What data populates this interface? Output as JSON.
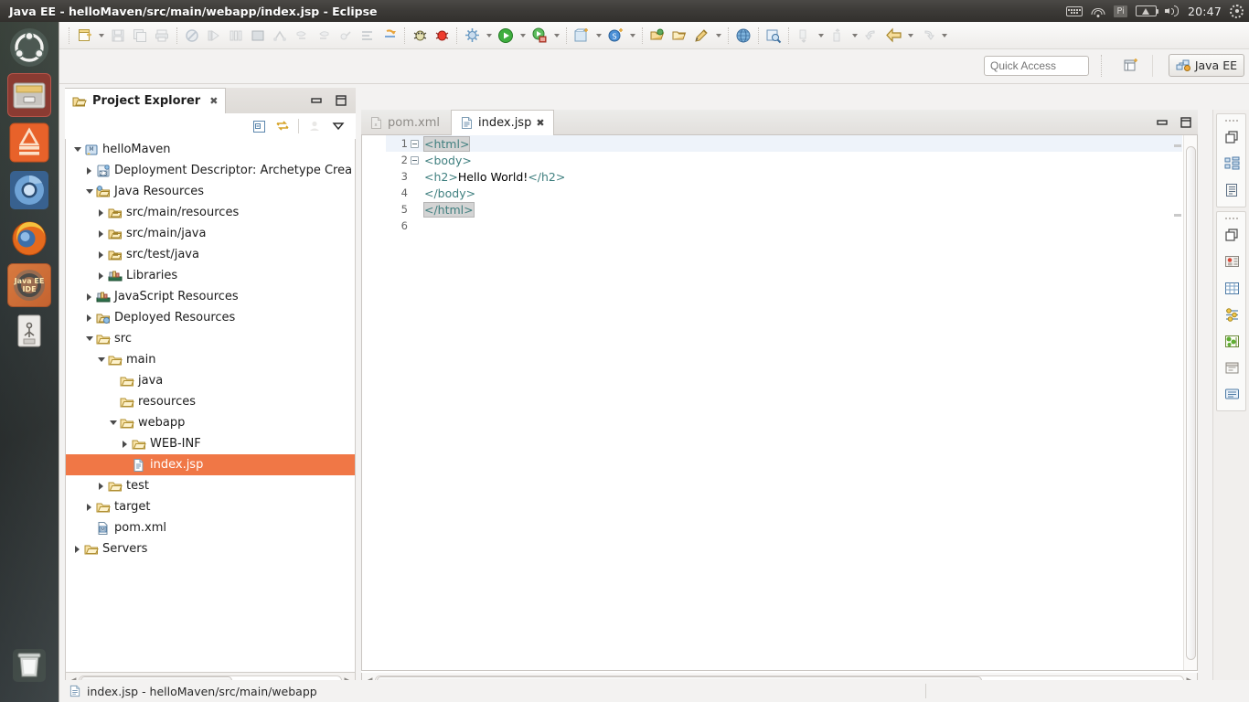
{
  "window": {
    "title": "Java EE - helloMaven/src/main/webapp/index.jsp - Eclipse"
  },
  "tray": {
    "keyboard_icon": "keyboard-icon",
    "wifi_icon": "wifi-icon",
    "pi_label": "Pi",
    "battery_icon": "battery-icon",
    "volume_icon": "volume-icon",
    "clock": "20:47",
    "session_icon": "gear-icon"
  },
  "launcher": {
    "items": [
      {
        "name": "ubuntu-dash",
        "label": "Ubuntu",
        "active": false
      },
      {
        "name": "files",
        "label": "Files",
        "active": false
      },
      {
        "name": "amazon",
        "label": "Amazon",
        "active": false
      },
      {
        "name": "chromium",
        "label": "Chromium Web Browser",
        "active": false
      },
      {
        "name": "firefox",
        "label": "Firefox Web Browser",
        "active": false
      },
      {
        "name": "java-ee-ide",
        "label": "Java EE IDE",
        "active": true
      },
      {
        "name": "usb-drive",
        "label": "USB Drive",
        "active": false
      },
      {
        "name": "trash",
        "label": "Trash",
        "active": false
      }
    ]
  },
  "toolbar": {
    "groups": [
      [
        "new-wizard",
        "new-dropdown",
        "save",
        "save-all",
        "print"
      ],
      [
        "no-entry",
        "run-last-tool",
        "build-all",
        "terminate-console",
        "link-items",
        "next-annotation",
        "prev-annotation",
        "last-edit-location",
        "toggle-mark-occurrences",
        "restore-skipped"
      ],
      [
        "debug-jsp",
        "debug-as",
        "debug-dropdown",
        "run-as",
        "run-dropdown",
        "run-server",
        "server-dropdown"
      ],
      [
        "new-ejb-project",
        "ejb-dropdown",
        "new-session-bean",
        "bean-dropdown"
      ],
      [
        "open-type",
        "open-task",
        "new-annotation",
        "annotation-dropdown"
      ],
      [
        "open-web-browser"
      ],
      [
        "search",
        "search-dropdown"
      ],
      [
        "next-edit",
        "next-dropdown",
        "prev-edit",
        "prev-dropdown",
        "back",
        "back-dropdown",
        "forward",
        "forward-dropdown"
      ]
    ]
  },
  "quick_access": {
    "placeholder": "Quick Access",
    "value": ""
  },
  "perspective": {
    "open_perspective_icon": "open-perspective-icon",
    "current": "Java EE",
    "current_icon": "java-ee-perspective-icon"
  },
  "project_explorer": {
    "title": "Project Explorer",
    "tab_icon": "project-explorer-icon",
    "close_icon": "close-icon",
    "minimize_icon": "minimize-icon",
    "maximize_icon": "maximize-icon",
    "toolbar": [
      {
        "name": "collapse-all-button",
        "icon": "collapse-all-icon"
      },
      {
        "name": "link-with-editor-button",
        "icon": "link-editor-icon"
      },
      {
        "name": "focus-on-active-task-button",
        "icon": "focus-task-icon"
      },
      {
        "name": "view-menu-button",
        "icon": "chevron-down-icon"
      }
    ],
    "tree": [
      {
        "label": "helloMaven",
        "indent": 0,
        "twisty": "expanded",
        "icon": "maven-project-icon",
        "selected": false
      },
      {
        "label": "Deployment Descriptor: Archetype Crea",
        "indent": 1,
        "twisty": "collapsed",
        "icon": "deployment-descriptor-icon",
        "selected": false
      },
      {
        "label": "Java Resources",
        "indent": 1,
        "twisty": "expanded",
        "icon": "java-resources-icon",
        "selected": false
      },
      {
        "label": "src/main/resources",
        "indent": 2,
        "twisty": "collapsed",
        "icon": "source-folder-icon",
        "selected": false
      },
      {
        "label": "src/main/java",
        "indent": 2,
        "twisty": "collapsed",
        "icon": "source-folder-icon",
        "selected": false
      },
      {
        "label": "src/test/java",
        "indent": 2,
        "twisty": "collapsed",
        "icon": "source-folder-icon",
        "selected": false
      },
      {
        "label": "Libraries",
        "indent": 2,
        "twisty": "collapsed",
        "icon": "libraries-icon",
        "selected": false
      },
      {
        "label": "JavaScript Resources",
        "indent": 1,
        "twisty": "collapsed",
        "icon": "libraries-icon",
        "selected": false
      },
      {
        "label": "Deployed Resources",
        "indent": 1,
        "twisty": "collapsed",
        "icon": "deployed-resources-icon",
        "selected": false
      },
      {
        "label": "src",
        "indent": 1,
        "twisty": "expanded",
        "icon": "folder-icon",
        "selected": false
      },
      {
        "label": "main",
        "indent": 2,
        "twisty": "expanded",
        "icon": "folder-icon",
        "selected": false
      },
      {
        "label": "java",
        "indent": 3,
        "twisty": "none",
        "icon": "folder-icon",
        "selected": false
      },
      {
        "label": "resources",
        "indent": 3,
        "twisty": "none",
        "icon": "folder-icon",
        "selected": false
      },
      {
        "label": "webapp",
        "indent": 3,
        "twisty": "expanded",
        "icon": "folder-icon",
        "selected": false
      },
      {
        "label": "WEB-INF",
        "indent": 4,
        "twisty": "collapsed",
        "icon": "folder-icon",
        "selected": false
      },
      {
        "label": "index.jsp",
        "indent": 4,
        "twisty": "none",
        "icon": "jsp-file-icon",
        "selected": true
      },
      {
        "label": "test",
        "indent": 2,
        "twisty": "collapsed",
        "icon": "folder-icon",
        "selected": false
      },
      {
        "label": "target",
        "indent": 1,
        "twisty": "collapsed",
        "icon": "folder-icon",
        "selected": false
      },
      {
        "label": "pom.xml",
        "indent": 1,
        "twisty": "none",
        "icon": "maven-pom-icon",
        "selected": false
      },
      {
        "label": "Servers",
        "indent": 0,
        "twisty": "collapsed",
        "icon": "folder-icon",
        "selected": false
      }
    ],
    "selection_color": "#f07746"
  },
  "editor": {
    "tabs": [
      {
        "label": "pom.xml",
        "icon": "xml-file-icon",
        "active": false,
        "closable": false
      },
      {
        "label": "index.jsp",
        "icon": "jsp-file-icon",
        "active": true,
        "closable": true,
        "close_icon": "close-icon"
      }
    ],
    "minimize_icon": "minimize-icon",
    "maximize_icon": "maximize-icon",
    "lines": [
      {
        "num": "1",
        "fold": true,
        "segments": [
          {
            "text": "<html>",
            "style": "tag",
            "matched": true
          }
        ],
        "current": true
      },
      {
        "num": "2",
        "fold": true,
        "segments": [
          {
            "text": "<body>",
            "style": "tag",
            "matched": false
          }
        ],
        "current": false
      },
      {
        "num": "3",
        "fold": false,
        "segments": [
          {
            "text": "<h2>",
            "style": "tag",
            "matched": false
          },
          {
            "text": "Hello World!",
            "style": "text",
            "matched": false
          },
          {
            "text": "</h2>",
            "style": "tag",
            "matched": false
          }
        ],
        "current": false
      },
      {
        "num": "4",
        "fold": false,
        "segments": [
          {
            "text": "</body>",
            "style": "tag",
            "matched": false
          }
        ],
        "current": false
      },
      {
        "num": "5",
        "fold": false,
        "segments": [
          {
            "text": "</html>",
            "style": "tag",
            "matched": true
          }
        ],
        "current": false
      },
      {
        "num": "6",
        "fold": false,
        "segments": [],
        "current": false
      }
    ],
    "syntax_colors": {
      "tag": "#3F7F7F",
      "text": "#000000",
      "line_highlight": "#EEF3FA"
    }
  },
  "fast_view_bar": {
    "groups": [
      {
        "grip": "drag-grip",
        "items": [
          "restore-icon",
          "outline-view-icon",
          "snippets-view-icon"
        ]
      },
      {
        "grip": "drag-grip",
        "items": [
          "restore-icon",
          "servers-view-icon",
          "data-source-explorer-icon",
          "properties-view-icon",
          "markers-view-icon",
          "problems-view-icon",
          "console-view-icon"
        ]
      }
    ]
  },
  "status_bar": {
    "icon": "jsp-file-icon",
    "text": "index.jsp - helloMaven/src/main/webapp"
  }
}
